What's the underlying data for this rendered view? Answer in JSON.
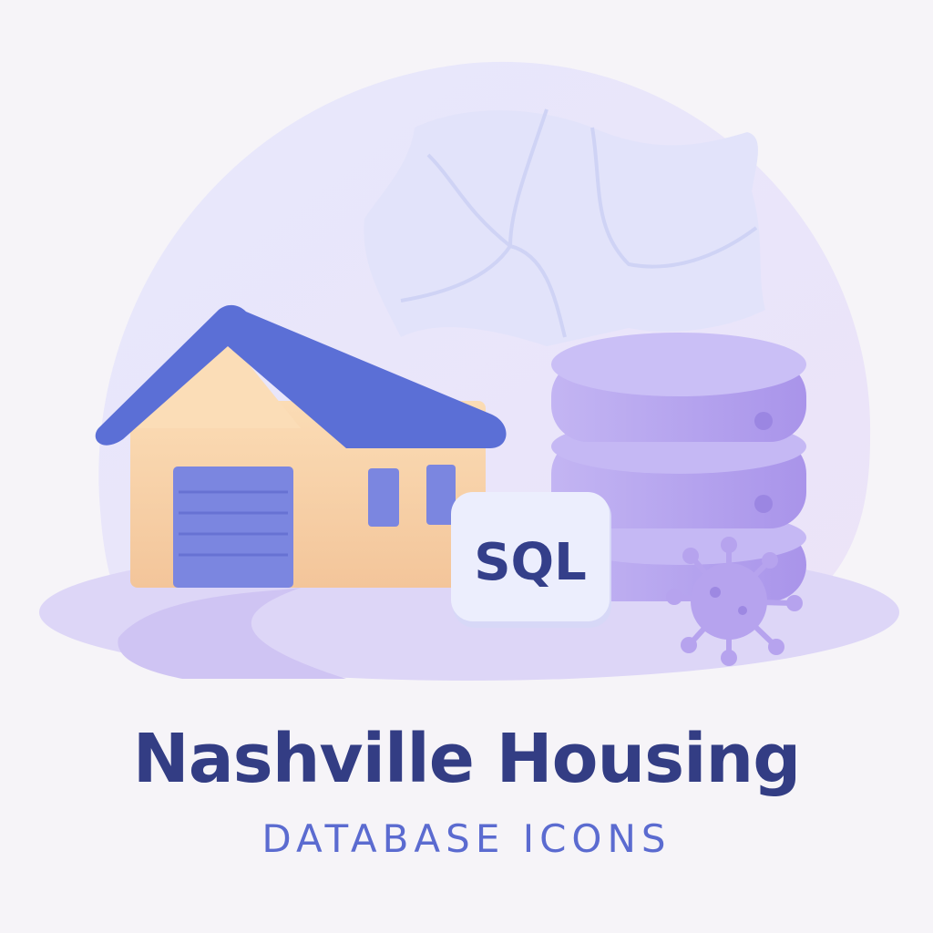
{
  "title": "Nashville Housing",
  "subtitle": "DATABASE ICONS",
  "badge_label": "SQL",
  "colors": {
    "background": "#f6f4f8",
    "title": "#333d84",
    "subtitle": "#5b6bd0",
    "roof": "#5b6fd6",
    "walls": "#f7d3a7",
    "database": "#b9a8ef"
  }
}
